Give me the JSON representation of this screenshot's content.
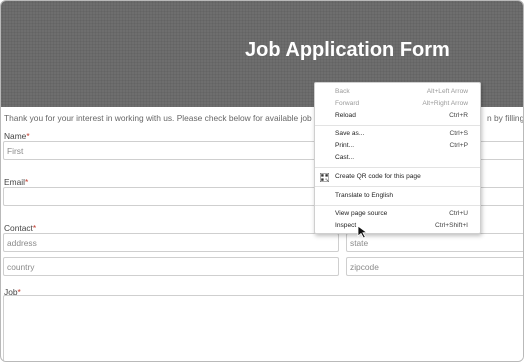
{
  "page": {
    "title": "Job Application Form",
    "intro": "Thank you for your interest in working with us. Please check below for available job opportunit",
    "intro_tail": "n by filling o"
  },
  "form": {
    "name_label": "Name",
    "first_placeholder": "First",
    "email_label": "Email",
    "contact_label": "Contact",
    "address_placeholder": "address",
    "state_placeholder": "state",
    "country_placeholder": "country",
    "zipcode_placeholder": "zipcode",
    "job_label": "Job",
    "required_mark": "*"
  },
  "context_menu": {
    "items": [
      {
        "label": "Back",
        "shortcut": "Alt+Left Arrow",
        "enabled": false
      },
      {
        "label": "Forward",
        "shortcut": "Alt+Right Arrow",
        "enabled": false
      },
      {
        "label": "Reload",
        "shortcut": "Ctrl+R",
        "enabled": true
      },
      {
        "label": "Save as...",
        "shortcut": "Ctrl+S",
        "enabled": true
      },
      {
        "label": "Print...",
        "shortcut": "Ctrl+P",
        "enabled": true
      },
      {
        "label": "Cast...",
        "shortcut": "",
        "enabled": true
      },
      {
        "label": "Create QR code for this page",
        "shortcut": "",
        "enabled": true
      },
      {
        "label": "Translate to English",
        "shortcut": "",
        "enabled": true
      },
      {
        "label": "View page source",
        "shortcut": "Ctrl+U",
        "enabled": true
      },
      {
        "label": "Inspect",
        "shortcut": "Ctrl+Shift+I",
        "enabled": true
      }
    ]
  },
  "colors": {
    "header_bg": "#6e6e6e",
    "required": "#c0392b"
  },
  "icons": {
    "qr": "qr-code-icon",
    "cursor": "mouse-pointer-icon"
  }
}
